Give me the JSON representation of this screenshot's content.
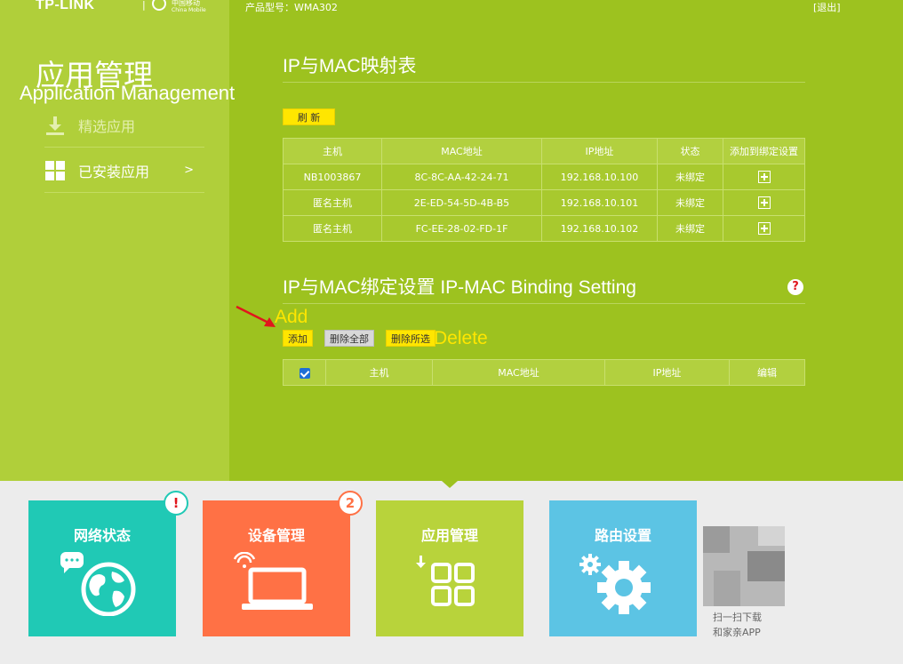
{
  "header": {
    "logo": "TP-LINK",
    "logo_sep": "|",
    "partner_cn": "中国移动",
    "partner_en": "China Mobile",
    "model": "产品型号：WMA302",
    "logout": "[退出]"
  },
  "sidebar": {
    "title": "应用管理",
    "title_en": "Application Management",
    "items": [
      {
        "label": "精选应用",
        "icon": "download-icon"
      },
      {
        "label": "已安装应用",
        "icon": "grid-icon",
        "arrow": ">"
      }
    ]
  },
  "mapping_table": {
    "title": "IP与MAC映射表",
    "refresh_label": "刷 新",
    "columns": [
      "主机",
      "MAC地址",
      "IP地址",
      "状态",
      "添加到绑定设置"
    ],
    "rows": [
      {
        "host": "NB1003867",
        "mac": "8C-8C-AA-42-24-71",
        "ip": "192.168.10.100",
        "status": "未绑定"
      },
      {
        "host": "匿名主机",
        "mac": "2E-ED-54-5D-4B-B5",
        "ip": "192.168.10.101",
        "status": "未绑定"
      },
      {
        "host": "匿名主机",
        "mac": "FC-EE-28-02-FD-1F",
        "ip": "192.168.10.102",
        "status": "未绑定"
      }
    ]
  },
  "binding": {
    "title": "IP与MAC绑定设置 IP-MAC Binding Setting",
    "help": "?",
    "add_label": "添加",
    "delete_all_label": "删除全部",
    "delete_selected_label": "删除所选",
    "annotation_add": "Add",
    "annotation_delete": "Delete",
    "columns": [
      "主机",
      "MAC地址",
      "IP地址",
      "编辑"
    ]
  },
  "tiles": [
    {
      "label": "网络状态",
      "color": "#20c9b5",
      "badge": "!",
      "icon": "globe-icon"
    },
    {
      "label": "设备管理",
      "color": "#ff7145",
      "badge": "2",
      "icon": "laptop-icon"
    },
    {
      "label": "应用管理",
      "color": "#b8d33b",
      "icon": "apps-icon"
    },
    {
      "label": "路由设置",
      "color": "#5cc4e4",
      "icon": "gear-icon"
    }
  ],
  "qr": {
    "line1": "扫一扫下载",
    "line2": "和家亲APP"
  },
  "colors": {
    "accent": "#9dc21f",
    "button_yellow": "#ffe600",
    "annotation": "#ffe600"
  }
}
